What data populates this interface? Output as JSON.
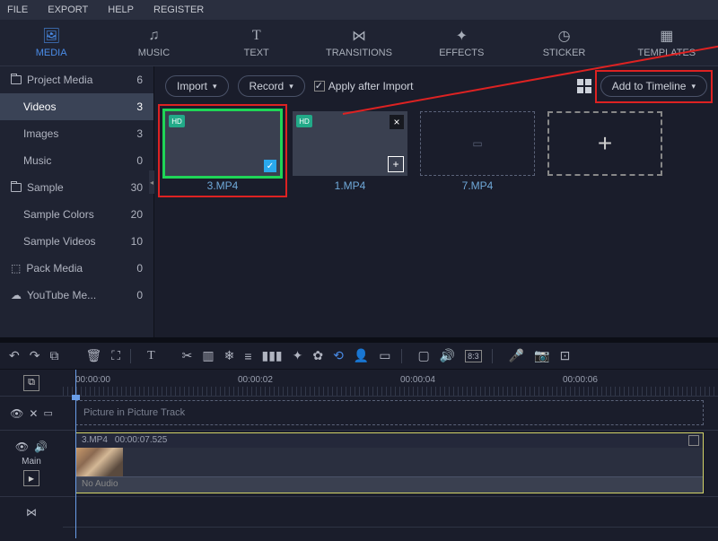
{
  "menubar": {
    "file": "FILE",
    "export": "EXPORT",
    "help": "HELP",
    "register": "REGISTER"
  },
  "tabs": [
    {
      "label": "MEDIA",
      "icon": "media-icon"
    },
    {
      "label": "MUSIC",
      "icon": "music-icon"
    },
    {
      "label": "TEXT",
      "icon": "text-icon"
    },
    {
      "label": "TRANSITIONS",
      "icon": "transitions-icon"
    },
    {
      "label": "EFFECTS",
      "icon": "effects-icon"
    },
    {
      "label": "STICKER",
      "icon": "sticker-icon"
    },
    {
      "label": "TEMPLATES",
      "icon": "templates-icon"
    }
  ],
  "active_tab": "MEDIA",
  "sidebar": {
    "items": [
      {
        "label": "Project Media",
        "count": "6",
        "icon": "folder-icon",
        "sub": false
      },
      {
        "label": "Videos",
        "count": "3",
        "icon": "",
        "sub": true,
        "selected": true
      },
      {
        "label": "Images",
        "count": "3",
        "icon": "",
        "sub": true
      },
      {
        "label": "Music",
        "count": "0",
        "icon": "",
        "sub": true
      },
      {
        "label": "Sample",
        "count": "30",
        "icon": "folder-icon",
        "sub": false
      },
      {
        "label": "Sample Colors",
        "count": "20",
        "icon": "",
        "sub": true
      },
      {
        "label": "Sample Videos",
        "count": "10",
        "icon": "",
        "sub": true
      },
      {
        "label": "Pack Media",
        "count": "0",
        "icon": "box-icon",
        "sub": false
      },
      {
        "label": "YouTube Me...",
        "count": "0",
        "icon": "cloud-icon",
        "sub": false
      }
    ]
  },
  "content_toolbar": {
    "import": "Import",
    "record": "Record",
    "apply_after_import": "Apply after Import",
    "add_to_timeline": "Add to Timeline"
  },
  "media": [
    {
      "caption": "3.MP4",
      "selected": true,
      "kind": "video"
    },
    {
      "caption": "1.MP4",
      "selected": false,
      "kind": "video"
    },
    {
      "caption": "7.MP4",
      "selected": false,
      "kind": "placeholder"
    }
  ],
  "timeline": {
    "ticks": [
      "00:00:00",
      "00:00:02",
      "00:00:04",
      "00:00:06"
    ],
    "pip_label": "Picture in Picture Track",
    "main_label": "Main",
    "clip": {
      "name": "3.MP4",
      "duration": "00:00:07.525",
      "audio_label": "No Audio"
    }
  },
  "colors": {
    "accent": "#4a8ce8",
    "highlight_green": "#1fd557",
    "highlight_red": "#d22",
    "clip_border": "#d4d468"
  }
}
